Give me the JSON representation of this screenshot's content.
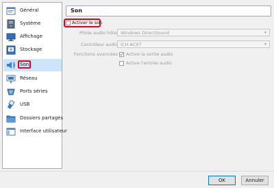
{
  "sidebar": {
    "items": [
      {
        "label": "Général",
        "icon": "general-icon"
      },
      {
        "label": "Système",
        "icon": "system-icon"
      },
      {
        "label": "Affichage",
        "icon": "display-icon"
      },
      {
        "label": "Stockage",
        "icon": "storage-icon"
      },
      {
        "label": "Son",
        "icon": "sound-icon"
      },
      {
        "label": "Réseau",
        "icon": "network-icon"
      },
      {
        "label": "Ports séries",
        "icon": "serial-ports-icon"
      },
      {
        "label": "USB",
        "icon": "usb-icon"
      },
      {
        "label": "Dossiers partagés",
        "icon": "shared-folders-icon"
      },
      {
        "label": "Interface utilisateur",
        "icon": "user-interface-icon"
      }
    ],
    "selected_index": 4
  },
  "section": {
    "title": "Son"
  },
  "audio": {
    "enable_label": "Activer le son",
    "enable_checked": false,
    "host_driver_label": "Pilote audio hôte :",
    "host_driver_value": "Windows DirectSound",
    "controller_label": "Contrôleur audio :",
    "controller_value": "ICH AC97",
    "advanced_label": "Fonctions avancées :",
    "output_label": "Active la sortie audio",
    "output_checked": true,
    "input_label": "Active l'entrée audio",
    "input_checked": false
  },
  "buttons": {
    "ok": "OK",
    "cancel": "Annuler"
  },
  "colors": {
    "highlight": "#e0001a",
    "selected_bg": "#cce5fb",
    "accent": "#0078d7"
  }
}
